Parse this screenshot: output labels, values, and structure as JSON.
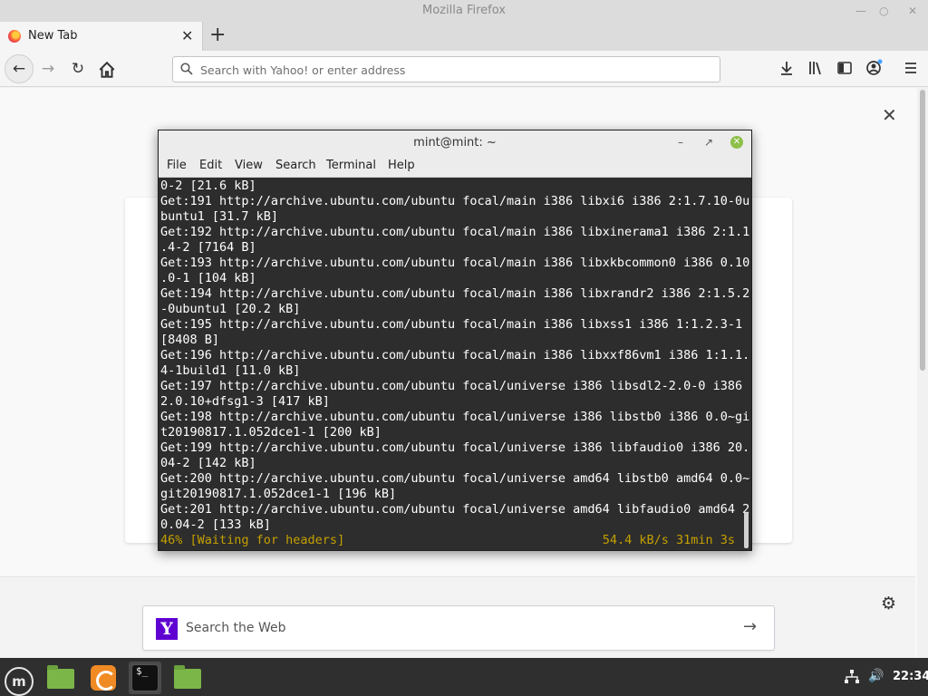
{
  "browser": {
    "window_title": "Mozilla Firefox",
    "tab_title": "New Tab",
    "url_placeholder": "Search with Yahoo! or enter address",
    "search_web_label": "Search the Web"
  },
  "terminal": {
    "title": "mint@mint: ~",
    "menu": [
      "File",
      "Edit",
      "View",
      "Search",
      "Terminal",
      "Help"
    ],
    "lines": [
      "0-2 [21.6 kB]",
      "Get:191 http://archive.ubuntu.com/ubuntu focal/main i386 libxi6 i386 2:1.7.10-0u",
      "buntu1 [31.7 kB]",
      "Get:192 http://archive.ubuntu.com/ubuntu focal/main i386 libxinerama1 i386 2:1.1",
      ".4-2 [7164 B]",
      "Get:193 http://archive.ubuntu.com/ubuntu focal/main i386 libxkbcommon0 i386 0.10",
      ".0-1 [104 kB]",
      "Get:194 http://archive.ubuntu.com/ubuntu focal/main i386 libxrandr2 i386 2:1.5.2",
      "-0ubuntu1 [20.2 kB]",
      "Get:195 http://archive.ubuntu.com/ubuntu focal/main i386 libxss1 i386 1:1.2.3-1",
      "[8408 B]",
      "Get:196 http://archive.ubuntu.com/ubuntu focal/main i386 libxxf86vm1 i386 1:1.1.",
      "4-1build1 [11.0 kB]",
      "Get:197 http://archive.ubuntu.com/ubuntu focal/universe i386 libsdl2-2.0-0 i386",
      "2.0.10+dfsg1-3 [417 kB]",
      "Get:198 http://archive.ubuntu.com/ubuntu focal/universe i386 libstb0 i386 0.0~gi",
      "t20190817.1.052dce1-1 [200 kB]",
      "Get:199 http://archive.ubuntu.com/ubuntu focal/universe i386 libfaudio0 i386 20.",
      "04-2 [142 kB]",
      "Get:200 http://archive.ubuntu.com/ubuntu focal/universe amd64 libstb0 amd64 0.0~",
      "git20190817.1.052dce1-1 [196 kB]",
      "Get:201 http://archive.ubuntu.com/ubuntu focal/universe amd64 libfaudio0 amd64 2",
      "0.04-2 [133 kB]"
    ],
    "status_left": "46% [Waiting for headers]",
    "status_right": "54.4 kB/s 31min 3s"
  },
  "taskbar": {
    "clock": "22:34"
  },
  "colors": {
    "terminal_bg": "#2d2d2d",
    "status_yellow": "#c4a000",
    "mint_accent": "#8ec04a",
    "yahoo_purple": "#5f01d1"
  }
}
